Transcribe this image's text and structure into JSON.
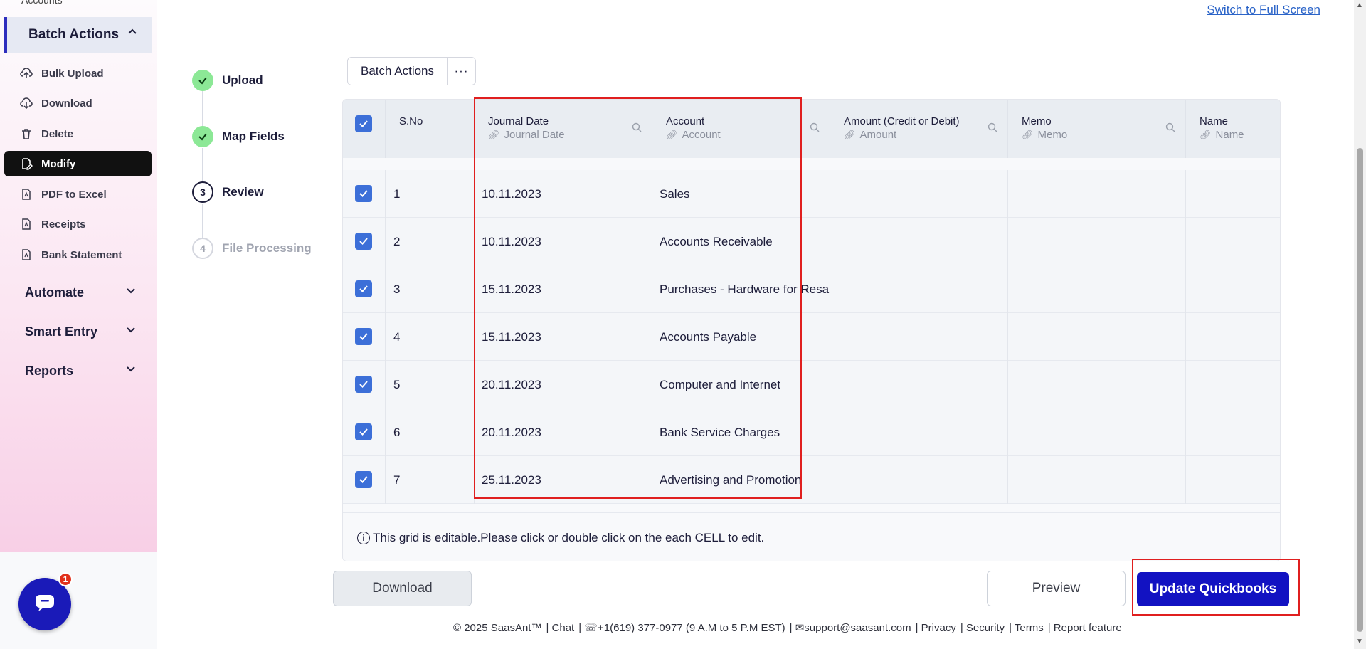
{
  "sidebar": {
    "partial_top_label": "Accounts",
    "section": {
      "label": "Batch Actions"
    },
    "items": [
      {
        "label": "Bulk Upload",
        "icon": "cloud-upload-icon"
      },
      {
        "label": "Download",
        "icon": "cloud-download-icon"
      },
      {
        "label": "Delete",
        "icon": "trash-icon"
      },
      {
        "label": "Modify",
        "icon": "edit-icon",
        "active": true
      },
      {
        "label": "PDF to Excel",
        "icon": "pdf-file-icon"
      },
      {
        "label": "Receipts",
        "icon": "pdf-file-icon"
      },
      {
        "label": "Bank Statement",
        "icon": "pdf-file-icon"
      }
    ],
    "groups": [
      {
        "label": "Automate"
      },
      {
        "label": "Smart Entry"
      },
      {
        "label": "Reports"
      }
    ],
    "chat_badge": "1"
  },
  "header": {
    "fullscreen_link": "Switch to Full Screen"
  },
  "steps": [
    {
      "label": "Upload",
      "state": "done"
    },
    {
      "label": "Map Fields",
      "state": "done"
    },
    {
      "number": "3",
      "label": "Review",
      "state": "current"
    },
    {
      "number": "4",
      "label": "File Processing",
      "state": "todo"
    }
  ],
  "toolbar": {
    "batch_actions_label": "Batch Actions",
    "more_label": "···"
  },
  "grid": {
    "columns": [
      {
        "title": "S.No",
        "sub": ""
      },
      {
        "title": "Journal Date",
        "sub": "Journal Date"
      },
      {
        "title": "Account",
        "sub": "Account"
      },
      {
        "title": "Amount (Credit or Debit)",
        "sub": "Amount"
      },
      {
        "title": "Memo",
        "sub": "Memo"
      },
      {
        "title": "Name",
        "sub": "Name"
      }
    ],
    "rows": [
      {
        "sno": "1",
        "date": "10.11.2023",
        "account": "Sales"
      },
      {
        "sno": "2",
        "date": "10.11.2023",
        "account": "Accounts Receivable"
      },
      {
        "sno": "3",
        "date": "15.11.2023",
        "account": "Purchases - Hardware for Resa"
      },
      {
        "sno": "4",
        "date": "15.11.2023",
        "account": "Accounts Payable"
      },
      {
        "sno": "5",
        "date": "20.11.2023",
        "account": "Computer and Internet"
      },
      {
        "sno": "6",
        "date": "20.11.2023",
        "account": "Bank Service Charges"
      },
      {
        "sno": "7",
        "date": "25.11.2023",
        "account": "Advertising and Promotion"
      }
    ],
    "footer_note": "This grid is editable.Please click or double click on the each CELL to edit."
  },
  "actions": {
    "download": "Download",
    "preview": "Preview",
    "update": "Update Quickbooks"
  },
  "footer": {
    "copyright": "© 2025 SaasAnt™",
    "chat": "| Chat",
    "phone": "| ☏+1(619) 377-0977 (9 A.M to 5 P.M EST)",
    "email": "| ✉support@saasant.com",
    "privacy": "| Privacy",
    "security": "| Security",
    "terms": "| Terms",
    "report": "| Report feature"
  },
  "colors": {
    "accent": "#1212c2",
    "highlight": "#e01f1f",
    "checkbox": "#3c6fd8",
    "step_done": "#8ce896"
  }
}
